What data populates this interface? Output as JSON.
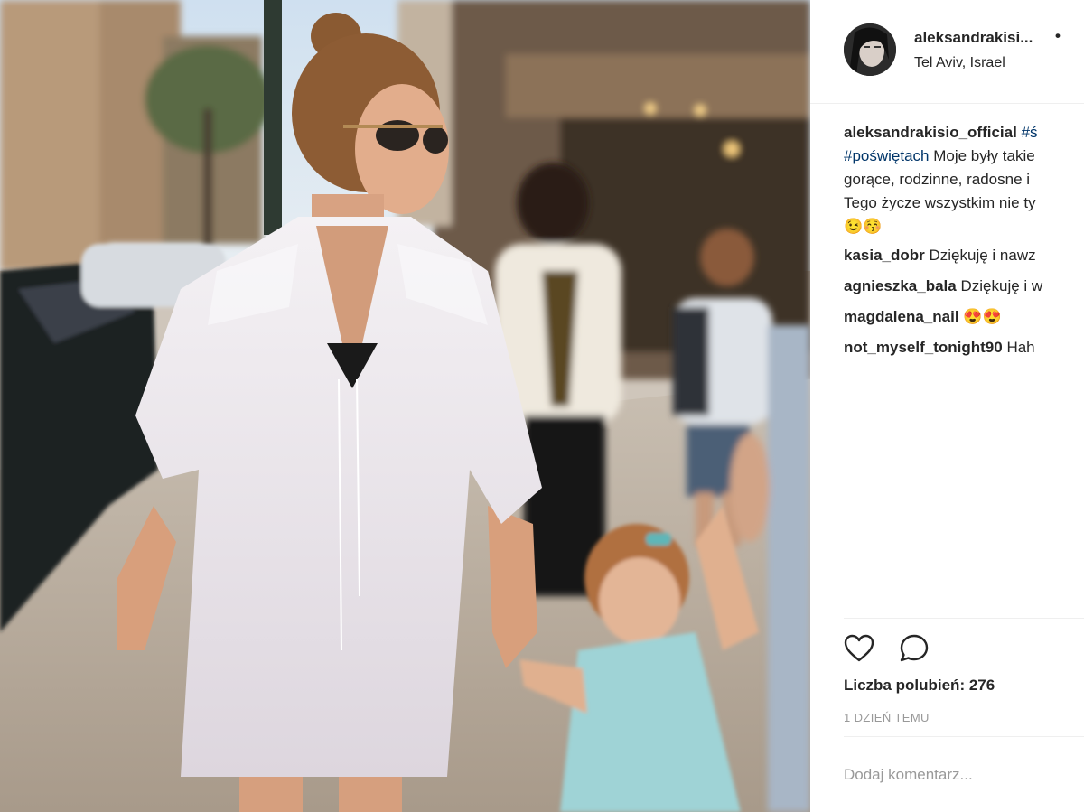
{
  "post": {
    "author": {
      "username_truncated": "aleksandrakisi...",
      "more_label": "•",
      "location": "Tel Aviv, Israel"
    },
    "caption": {
      "username": "aleksandrakisio_official",
      "line1_tag": "#ś",
      "line2_tag": "#poświętach",
      "line2_text": " Moje były takie",
      "line3_text": "gorące, rodzinne, radosne i",
      "line4_text": "Tego życze wszystkim nie ty",
      "line5_emoji": "😉😚"
    },
    "comments": [
      {
        "user": "kasia_dobr",
        "text": "Dziękuję i nawz"
      },
      {
        "user": "agnieszka_bala",
        "text": "Dziękuję i w"
      },
      {
        "user": "magdalena_nail",
        "text": "😍😍"
      },
      {
        "user": "not_myself_tonight90",
        "text": "Hah"
      }
    ],
    "likes_label": "Liczba polubień: 276",
    "timestamp": "1 DZIEŃ TEMU",
    "comment_input": {
      "placeholder": "Dodaj komentarz..."
    },
    "icons": [
      "heart-icon",
      "comment-icon"
    ]
  }
}
